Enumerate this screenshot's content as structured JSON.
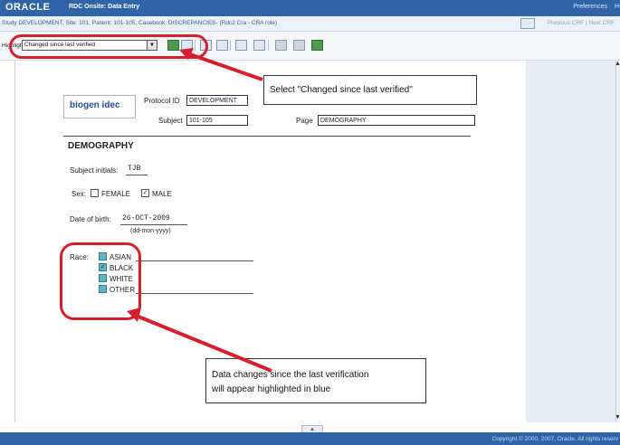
{
  "header": {
    "logo": "ORACLE",
    "app_title": "RDC Onsite: Data Entry",
    "preferences": "Preferences",
    "help_fragment": "H"
  },
  "study_bar": {
    "text": "Study DEVELOPMENT, Site: 101, Patient: 101-105, Casebook: DISCREPANCIES- (Rdc2 Cra - CRA role)",
    "crf_nav": "Previous CRF | Next CRF"
  },
  "toolbar": {
    "highlight_label": "Highlight",
    "highlight_value": "Changed since last verified",
    "icons": [
      "mark-verified-icon",
      "mark-reviewed-icon",
      "approve-icon",
      "history-icon",
      "discrepancy-icon",
      "investigator-comment-icon",
      "delete-icon",
      "print-icon",
      "save-icon"
    ]
  },
  "form": {
    "sponsor_logo": "biogen idec",
    "protocol_label": "Protocol ID",
    "protocol_value": "DEVELOPMENT",
    "subject_label": "Subject",
    "subject_value": "101-105",
    "page_label": "Page",
    "page_value": "DEMOGRAPHY",
    "section_title": "DEMOGRAPHY",
    "initials_label": "Subject initials:",
    "initials_value": "TJB",
    "sex_label": "Sex:",
    "sex_female": "FEMALE",
    "sex_male": "MALE",
    "sex_selected": "MALE",
    "dob_label": "Date of birth:",
    "dob_value": "26-OCT-2009",
    "dob_format": "(dd-mon-yyyy)",
    "race_label": "Race:",
    "race_options": [
      "ASIAN",
      "BLACK",
      "WHITE",
      "OTHER"
    ],
    "race_selected": "BLACK"
  },
  "callouts": {
    "select_hint": "Select \"Changed since last verified\"",
    "changes_line1": "Data changes since the last verification",
    "changes_line2": "will appear highlighted in blue"
  },
  "footer": {
    "copyright": "Copyright © 2000, 2007, Oracle. All rights reserv"
  },
  "colors": {
    "header_blue": "#2f64a8",
    "highlight_red": "#d61f2c",
    "changed_teal": "#5fb6c2"
  }
}
